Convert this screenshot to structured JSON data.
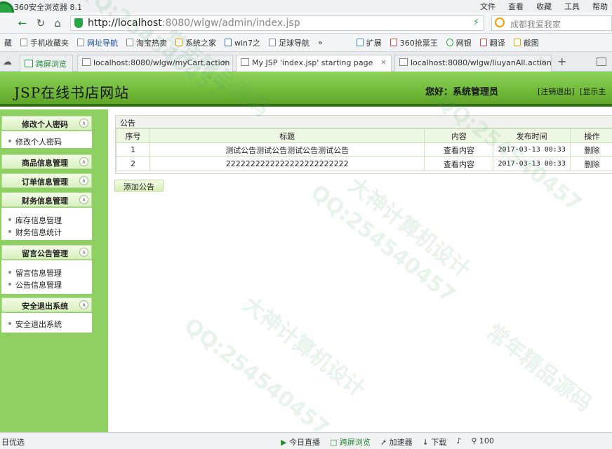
{
  "browser": {
    "app_title": "360安全浏览器 8.1",
    "menus": [
      "文件",
      "查看",
      "收藏",
      "工具",
      "帮助"
    ],
    "url_host": "http://localhost",
    "url_rest": ":8080/wlgw/admin/index.jsp",
    "search_placeholder": "成都我爱我家",
    "bookmarks": [
      "藏",
      "手机收藏夹",
      "网址导航",
      "淘宝热卖",
      "系统之家",
      "win7之",
      "足球导航",
      "»",
      "扩展",
      "360抢票王",
      "网银",
      "翻译",
      "截图"
    ],
    "tabs": [
      {
        "label": "跨屏浏览"
      },
      {
        "label": "localhost:8080/wlgw/myCart.action"
      },
      {
        "label": "My JSP 'index.jsp' starting page"
      },
      {
        "label": "localhost:8080/wlgw/liuyanAll.action"
      }
    ],
    "new_tab": "+"
  },
  "header": {
    "site_title": "JSP在线书店网站",
    "greeting": "您好：系统管理员",
    "logout": "[注销退出]",
    "show_main": "[显示主"
  },
  "sidebar": {
    "sections": [
      {
        "title": "修改个人密码",
        "items": [
          "修改个人密码"
        ]
      },
      {
        "title": "商品信息管理",
        "items": []
      },
      {
        "title": "订单信息管理",
        "items": []
      },
      {
        "title": "财务信息管理",
        "items": [
          "库存信息管理",
          "财务信息统计"
        ]
      },
      {
        "title": "留言公告管理",
        "items": [
          "留言信息管理",
          "公告信息管理"
        ]
      },
      {
        "title": "安全退出系统",
        "items": [
          "安全退出系统"
        ]
      }
    ]
  },
  "main": {
    "panel_title": "公告",
    "columns": [
      "序号",
      "标题",
      "内容",
      "发布时间",
      "操作"
    ],
    "rows": [
      {
        "no": "1",
        "title": "测试公告测试公告测试公告测试公告",
        "content": "查看内容",
        "time": "2017-03-13 00:33",
        "action": "删除"
      },
      {
        "no": "2",
        "title": "2222222222222222222222222",
        "content": "查看内容",
        "time": "2017-03-13 00:33",
        "action": "删除"
      }
    ],
    "add_button": "添加公告"
  },
  "statusbar": {
    "left": "日优选",
    "items": [
      "今日直播",
      "跨屏浏览",
      "加速器",
      "下载",
      "100"
    ]
  },
  "watermarks": [
    "QQ:254540457",
    "大神计算机设计",
    "常年精品源码"
  ],
  "colors": {
    "header_green": "#74bd3c",
    "sidebar_green": "#8fd062",
    "accent_dark": "#2f6e12"
  }
}
